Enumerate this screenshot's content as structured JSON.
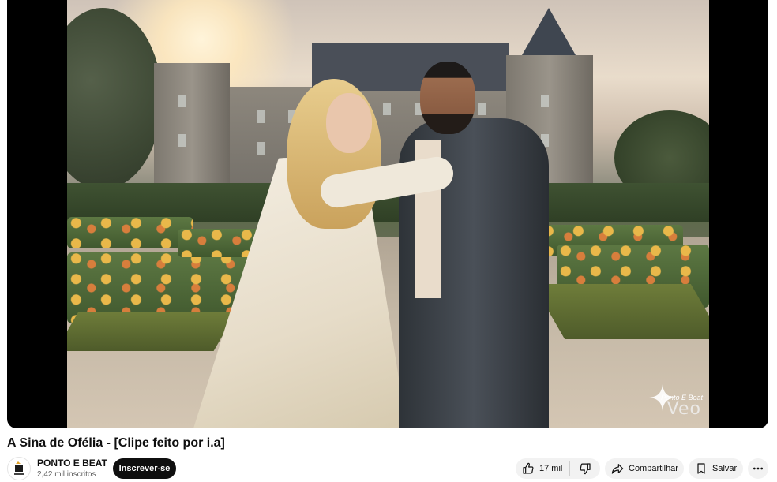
{
  "video": {
    "title": "A Sina de Ofélia - [Clipe feito por i.a]",
    "watermark": "Veo",
    "watermark_logo": "Ponto E Beat"
  },
  "channel": {
    "name": "PONTO E BEAT",
    "subscribers": "2,42 mil inscritos",
    "subscribe_label": "Inscrever-se"
  },
  "actions": {
    "likes": "17 mil",
    "share_label": "Compartilhar",
    "save_label": "Salvar"
  },
  "icons": {
    "like": "thumbs-up-icon",
    "dislike": "thumbs-down-icon",
    "share": "share-arrow-icon",
    "save": "bookmark-icon",
    "more": "more-horizontal-icon"
  },
  "colors": {
    "subscribe_bg": "#0f0f0f",
    "pill_bg": "#f2f2f2",
    "player_bg": "#000000"
  }
}
